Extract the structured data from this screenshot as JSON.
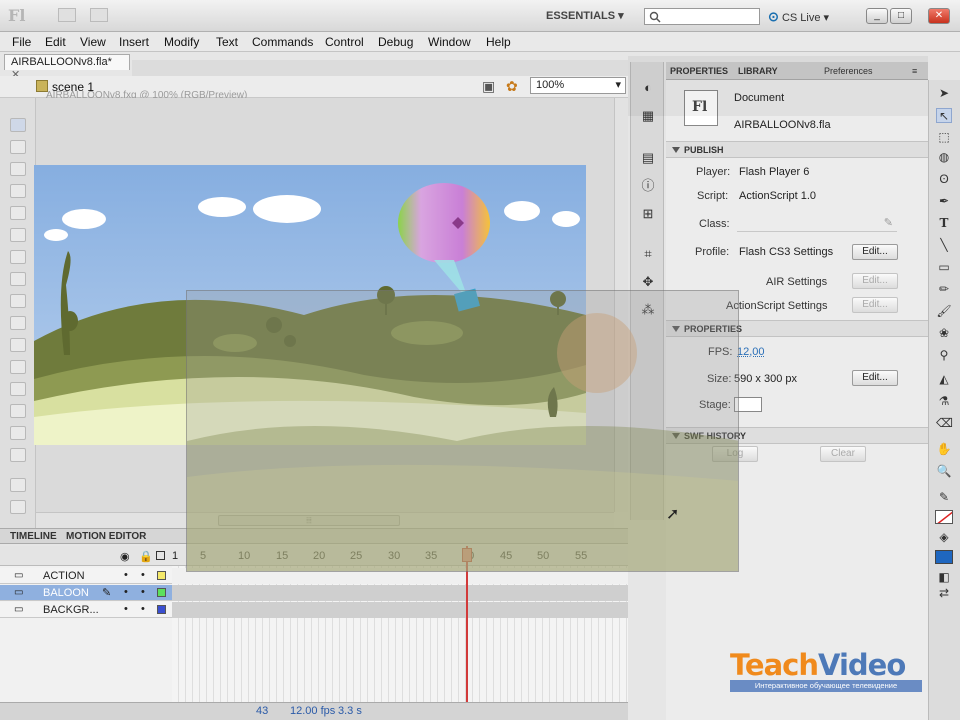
{
  "app": {
    "logo": "Fl",
    "workspace": "ESSENTIALS",
    "cs_live": "CS Live",
    "search_placeholder": ""
  },
  "window_controls": [
    "_",
    "□",
    "✕"
  ],
  "menu": [
    "File",
    "Edit",
    "View",
    "Insert",
    "Modify",
    "Text",
    "Commands",
    "Control",
    "Debug",
    "Window",
    "Help"
  ],
  "document_tab": "AIRBALLOONv8.fla*",
  "edit_bar": {
    "scene": "scene 1",
    "zoom": "100%",
    "ghost_title": "AIRBALLOONv8.fxg @ 100% (RGB/Preview)"
  },
  "timeline": {
    "tabs": [
      "TIMELINE",
      "MOTION EDITOR"
    ],
    "frame_numbers": [
      "1",
      "5",
      "10",
      "15",
      "20",
      "25",
      "30",
      "35",
      "40",
      "45",
      "50",
      "55"
    ],
    "current_frame_fraction": 0.75,
    "layers": [
      {
        "name": "ACTION",
        "color": "#f5e96a",
        "selected": false
      },
      {
        "name": "BALOON",
        "color": "#5ce05c",
        "selected": true
      },
      {
        "name": "BACKGR...",
        "color": "#3a4fd0",
        "selected": false
      }
    ],
    "footer": {
      "frame": "43",
      "fps": "12.00 fps",
      "time": "3.3 s"
    }
  },
  "properties": {
    "tabs": [
      "PROPERTIES",
      "LIBRARY",
      "Preferences"
    ],
    "doc_type": "Document",
    "doc_icon": "Fl",
    "doc_name": "AIRBALLOONv8.fla",
    "publish_header": "PUBLISH",
    "player_label": "Player:",
    "player_value": "Flash Player 6",
    "script_label": "Script:",
    "script_value": "ActionScript 1.0",
    "class_label": "Class:",
    "profile_label": "Profile:",
    "profile_value": "Flash CS3 Settings",
    "edit_label": "Edit...",
    "air_label": "AIR Settings",
    "as_label": "ActionScript Settings",
    "properties_header": "PROPERTIES",
    "fps_label": "FPS:",
    "fps_value": "12,00",
    "size_label": "Size:",
    "size_value": "590 x 300 px",
    "stage_label": "Stage:",
    "history_header": "SWF HISTORY",
    "log_label": "Log",
    "clear_label": "Clear"
  },
  "watermark": {
    "brand_a": "Teach",
    "brand_b": "Video",
    "tagline": "Интерактивное обучающее телевидение"
  },
  "colors": {
    "accent": "#2a6fb8",
    "stage_sky": "#8fb4e0",
    "hill_dark": "#6d7a3a",
    "hill_light": "#dfe6a8",
    "playhead": "#d23a3a"
  }
}
